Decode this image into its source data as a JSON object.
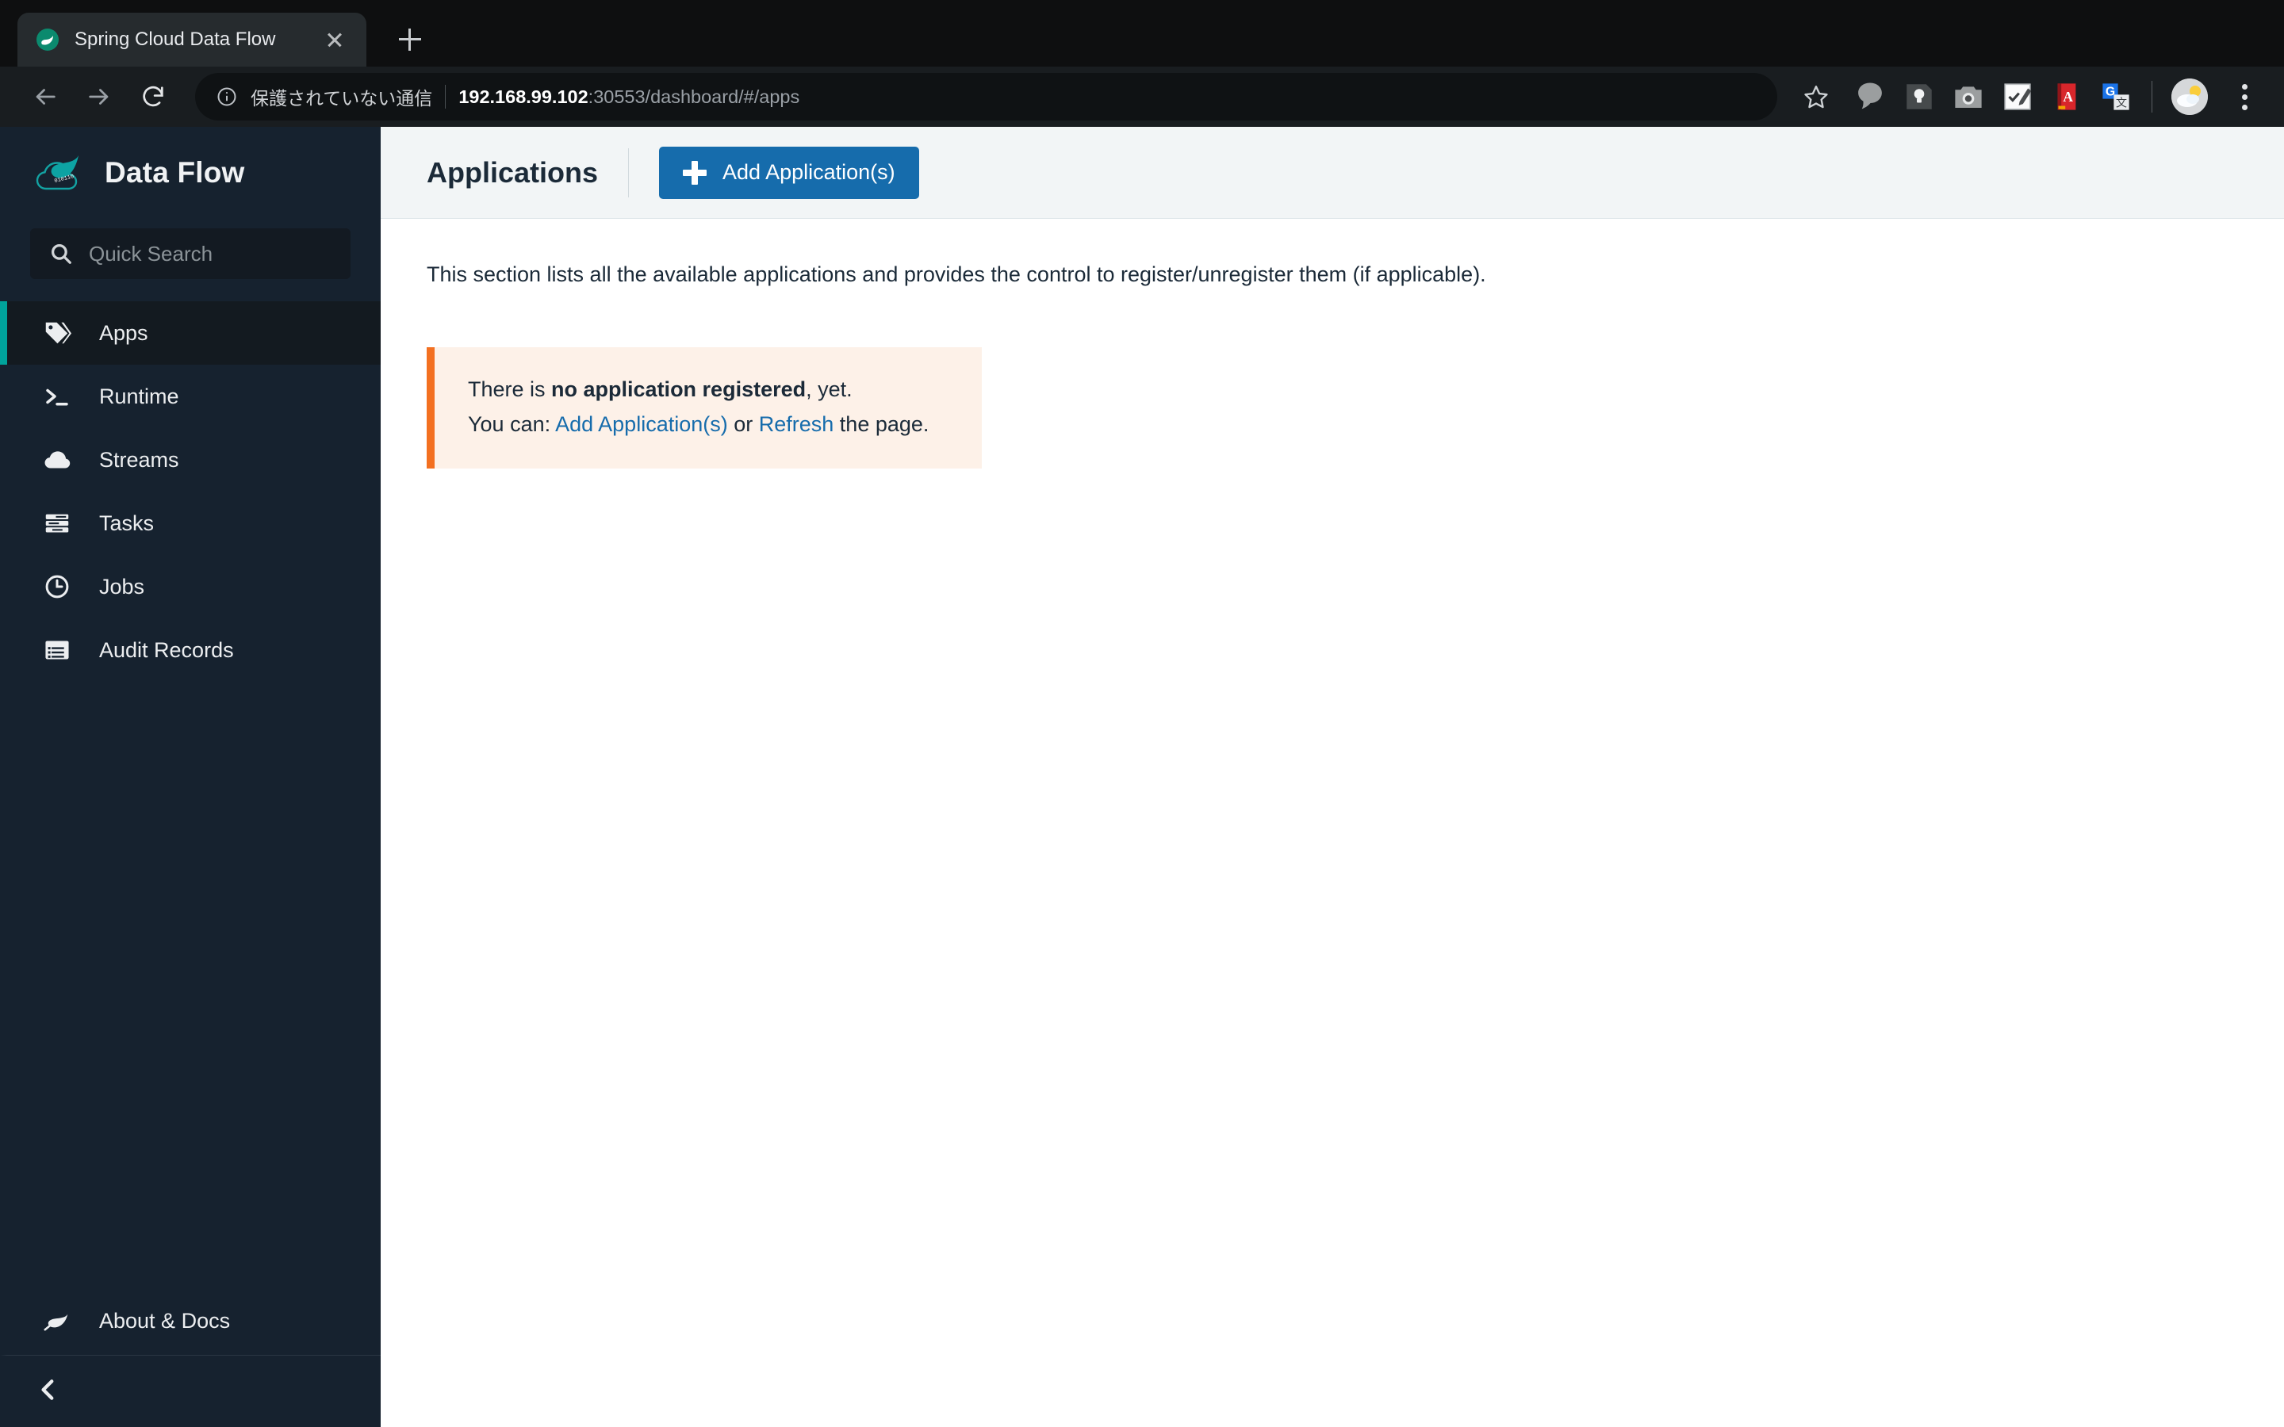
{
  "browser": {
    "tab": {
      "title": "Spring Cloud Data Flow",
      "favicon_icon": "spring-leaf-favicon",
      "close_icon": "close-icon"
    },
    "new_tab_icon": "plus-icon",
    "back_icon": "back-arrow-icon",
    "forward_icon": "forward-arrow-icon",
    "reload_icon": "reload-icon",
    "omnibox": {
      "info_icon": "info-circle-icon",
      "security_label": "保護されていない通信",
      "url_host": "192.168.99.102",
      "url_rest": ":30553/dashboard/#/apps"
    },
    "star_icon": "bookmark-star-icon",
    "extensions": [
      {
        "name": "speech-bubble-extension-icon"
      },
      {
        "name": "lightbulb-note-extension-icon"
      },
      {
        "name": "camera-extension-icon"
      },
      {
        "name": "checklist-edit-extension-icon"
      },
      {
        "name": "red-dictionary-extension-icon"
      },
      {
        "name": "google-translate-extension-icon"
      }
    ],
    "avatar_icon": "weather-cloud-sun-avatar",
    "menu_icon": "three-dot-menu-icon"
  },
  "sidebar": {
    "brand": {
      "logo_icon": "spring-cloud-data-flow-logo",
      "name": "Data Flow"
    },
    "search": {
      "icon": "search-icon",
      "placeholder": "Quick Search",
      "value": ""
    },
    "items": [
      {
        "label": "Apps",
        "icon": "tag-icon",
        "active": true
      },
      {
        "label": "Runtime",
        "icon": "terminal-icon",
        "active": false
      },
      {
        "label": "Streams",
        "icon": "cloud-icon",
        "active": false
      },
      {
        "label": "Tasks",
        "icon": "server-icon",
        "active": false
      },
      {
        "label": "Jobs",
        "icon": "clock-icon",
        "active": false
      },
      {
        "label": "Audit Records",
        "icon": "list-window-icon",
        "active": false
      }
    ],
    "about": {
      "label": "About & Docs",
      "icon": "leaf-icon"
    },
    "collapse_icon": "chevron-left-icon",
    "accent_color": "#00a39b",
    "background_color": "#16222f"
  },
  "main": {
    "title": "Applications",
    "add_button_label": "Add Application(s)",
    "add_button_icon": "plus-icon",
    "description": "This section lists all the available applications and provides the control to register/unregister them (if applicable).",
    "alert": {
      "line1_prefix": "There is ",
      "line1_bold": "no application registered",
      "line1_suffix": ", yet.",
      "line2_prefix": "You can: ",
      "link1": "Add Application(s)",
      "line2_middle": " or ",
      "link2": "Refresh",
      "line2_suffix": " the page.",
      "border_color": "#f37021",
      "background_color": "#fdf1e8"
    }
  }
}
